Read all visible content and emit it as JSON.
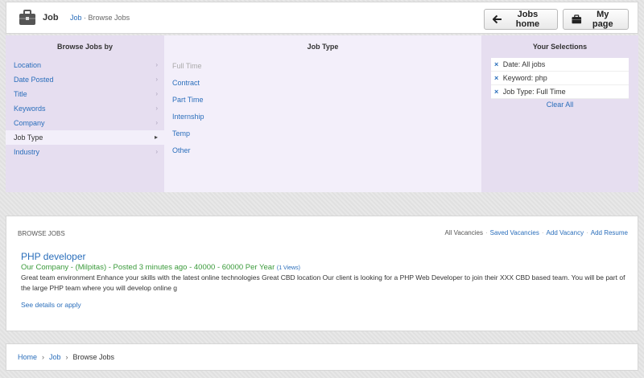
{
  "header": {
    "brand_title": "Job",
    "crumb_link": "Job",
    "crumb_sep": "·",
    "crumb_current": "Browse Jobs",
    "jobs_home_label": "Jobs home",
    "my_page_label": "My page"
  },
  "browse": {
    "left_heading": "Browse Jobs by",
    "categories": [
      {
        "label": "Location",
        "arrow": "›"
      },
      {
        "label": "Date Posted",
        "arrow": "›"
      },
      {
        "label": "Title",
        "arrow": "›"
      },
      {
        "label": "Keywords",
        "arrow": "›"
      },
      {
        "label": "Company",
        "arrow": "›"
      },
      {
        "label": "Job Type",
        "arrow": "▸"
      },
      {
        "label": "Industry",
        "arrow": "›"
      }
    ],
    "mid_heading": "Job Type",
    "options": [
      "Full Time",
      "Contract",
      "Part Time",
      "Internship",
      "Temp",
      "Other"
    ],
    "right_heading": "Your Selections",
    "selections": [
      "Date: All jobs",
      "Keyword: php",
      "Job Type: Full Time"
    ],
    "remove_symbol": "×",
    "clear_all": "Clear All"
  },
  "results": {
    "title": "BROWSE JOBS",
    "links": {
      "all": "All Vacancies",
      "saved": "Saved Vacancies",
      "add_vacancy": "Add Vacancy",
      "add_resume": "Add Resume",
      "sep": "·"
    },
    "job": {
      "title": "PHP developer",
      "meta": "Our Company - (Milpitas) - Posted 3 minutes ago - 40000 - 60000 Per Year",
      "views": "(1 Views)",
      "description": "Great team environment Enhance your skills with the latest online technologies Great CBD location Our client is looking for a PHP Web Developer to join their XXX CBD based team. You will be part of the large PHP team where you will develop online g",
      "details_link": "See details or apply"
    }
  },
  "breadcrumb": {
    "home": "Home",
    "job": "Job",
    "current": "Browse Jobs",
    "chev": "›"
  },
  "icons": {
    "briefcase": "briefcase-icon",
    "arrow_left": "arrow-left-icon"
  }
}
